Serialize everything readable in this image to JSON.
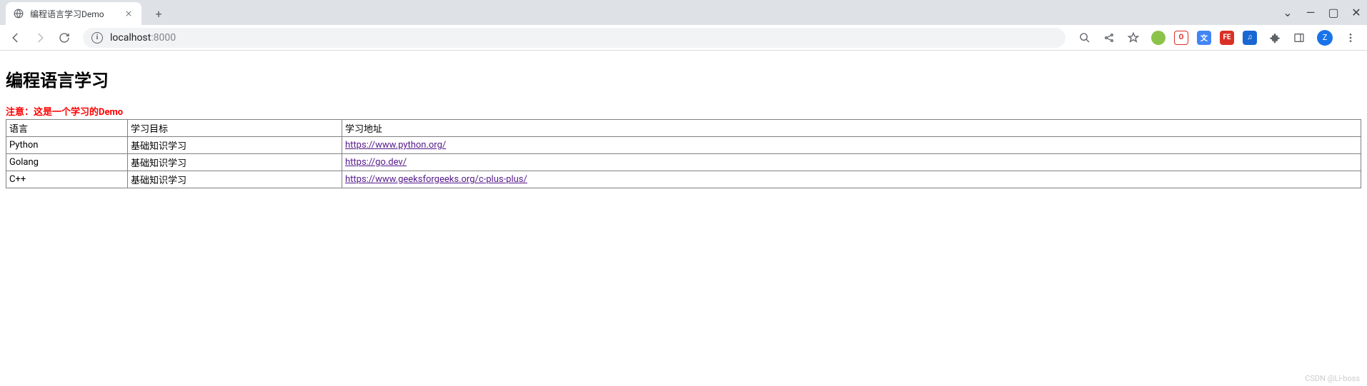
{
  "browser": {
    "tab": {
      "title": "编程语言学习Demo",
      "favicon": "globe"
    },
    "window_controls": {
      "chevron": "⌄",
      "minimize": "—",
      "maximize": "▢",
      "close": "✕"
    },
    "address": {
      "host": "localhost",
      "port": ":8000"
    },
    "extensions": [
      {
        "name": "ext-green",
        "color": "#8bc34a",
        "label": ""
      },
      {
        "name": "ext-red-o",
        "color": "#ffffff",
        "label": "O",
        "text_color": "#d93025",
        "border": "#d93025"
      },
      {
        "name": "ext-translate",
        "color": "#4285f4",
        "label": "文"
      },
      {
        "name": "ext-fe",
        "color": "#d93025",
        "label": "FE"
      },
      {
        "name": "ext-blue",
        "color": "#1967d2",
        "label": "♫"
      }
    ],
    "avatar_letter": "Z"
  },
  "page": {
    "heading": "编程语言学习",
    "notice": "注意：这是一个学习的Demo",
    "table": {
      "headers": [
        "语言",
        "学习目标",
        "学习地址"
      ],
      "rows": [
        {
          "lang": "Python",
          "goal": "基础知识学习",
          "url": "https://www.python.org/"
        },
        {
          "lang": "Golang",
          "goal": "基础知识学习",
          "url": "https://go.dev/"
        },
        {
          "lang": "C++",
          "goal": "基础知识学习",
          "url": "https://www.geeksforgeeks.org/c-plus-plus/"
        }
      ]
    }
  },
  "watermark": "CSDN @Li-boss"
}
